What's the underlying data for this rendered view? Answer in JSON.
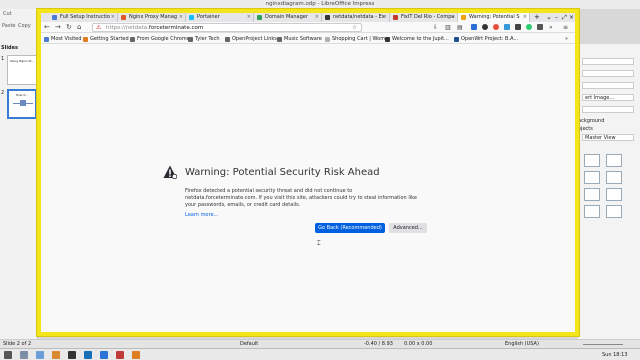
{
  "impress": {
    "window_title": "nginxdiagram.odp - LibreOffice Impress",
    "slides_label": "Slides",
    "slide1_title": "Using Nginx Pr...",
    "slide2_title": "How it...",
    "panel_items": [
      "ert Image...",
      "ackground",
      "ojects",
      "Master View"
    ],
    "status": {
      "slide": "Slide 2 of 2",
      "layout": "Default",
      "pos": "-0.40 / 8.93",
      "size": "0.00 x 0.00",
      "lang": "English (USA)"
    },
    "toolbar_fragments": {
      "cut": "Cut",
      "paste": "Paste",
      "copy": "Copy"
    }
  },
  "firefox": {
    "tabs": [
      {
        "label": "Full Setup Instructio",
        "color": "#4a7bd0"
      },
      {
        "label": "Nginx Proxy Manag",
        "color": "#e05a2b"
      },
      {
        "label": "Portainer",
        "color": "#13bef9"
      },
      {
        "label": "Domain Manager",
        "color": "#2e9e5b"
      },
      {
        "label": "netdata/netdata - Ex",
        "color": "#333333"
      },
      {
        "label": "FixIT Del Rio - Compu",
        "color": "#c0392b"
      },
      {
        "label": "Warning: Potential S",
        "color": "#f0a30a"
      }
    ],
    "url_prefix": "https://netdata.",
    "url_domain": "forceterminate.com",
    "bookmarks": [
      "Most Visited",
      "Getting Started",
      "From Google Chrome",
      "Tyler Tech",
      "OpenProject Links",
      "Music Software",
      "Shopping Cart | Wom...",
      "Welcome to the Jupit...",
      "OpenWrt Project: B.A..."
    ],
    "warning": {
      "title": "Warning: Potential Security Risk Ahead",
      "body": "Firefox detected a potential security threat and did not continue to netdata.forceterminate.com. If you visit this site, attackers could try to steal information like your passwords, emails, or credit card details.",
      "learn_more": "Learn more...",
      "go_back": "Go Back (Recommended)",
      "advanced": "Advanced..."
    }
  },
  "taskbar": {
    "clock": "Sun 18:13"
  }
}
